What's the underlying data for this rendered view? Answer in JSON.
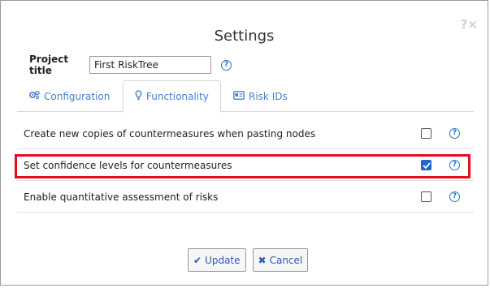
{
  "dialog": {
    "title": "Settings",
    "top_icons": {
      "help": "?",
      "close": "×"
    }
  },
  "project": {
    "label": "Project title",
    "value": "First RiskTree",
    "help_icon": "?"
  },
  "tabs": [
    {
      "label": "Configuration",
      "icon": "gears-icon",
      "active": false
    },
    {
      "label": "Functionality",
      "icon": "lightbulb-icon",
      "active": true
    },
    {
      "label": "Risk IDs",
      "icon": "id-card-icon",
      "active": false
    }
  ],
  "options": [
    {
      "label": "Create new copies of countermeasures when pasting nodes",
      "checked": false,
      "help": "?"
    },
    {
      "label": "Set confidence levels for countermeasures",
      "checked": true,
      "help": "?"
    },
    {
      "label": "Enable quantitative assessment of risks",
      "checked": false,
      "help": "?"
    }
  ],
  "buttons": {
    "update": "Update",
    "cancel": "Cancel"
  },
  "colors": {
    "accent": "#2e6fc7",
    "highlight": "#e0101c",
    "checkbox_checked": "#1f66d1"
  }
}
